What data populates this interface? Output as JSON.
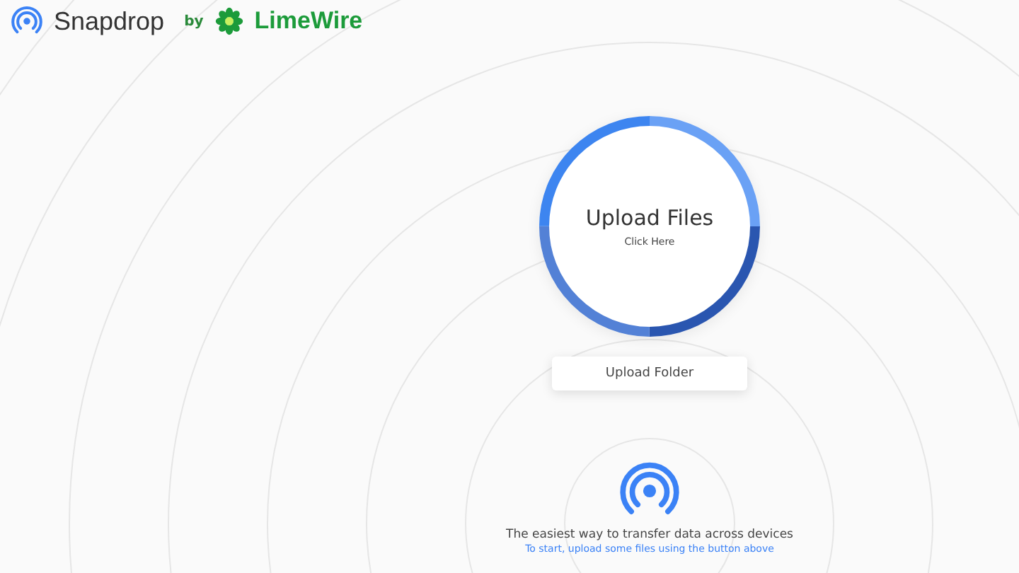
{
  "header": {
    "app_name": "Snapdrop",
    "by": "by",
    "partner": "LimeWire"
  },
  "upload_files": {
    "title": "Upload Files",
    "subtitle": "Click Here"
  },
  "upload_folder": {
    "label": "Upload Folder"
  },
  "footer": {
    "tagline": "The easiest way to transfer data across devices",
    "hint": "To start, upload some files using the button above"
  }
}
